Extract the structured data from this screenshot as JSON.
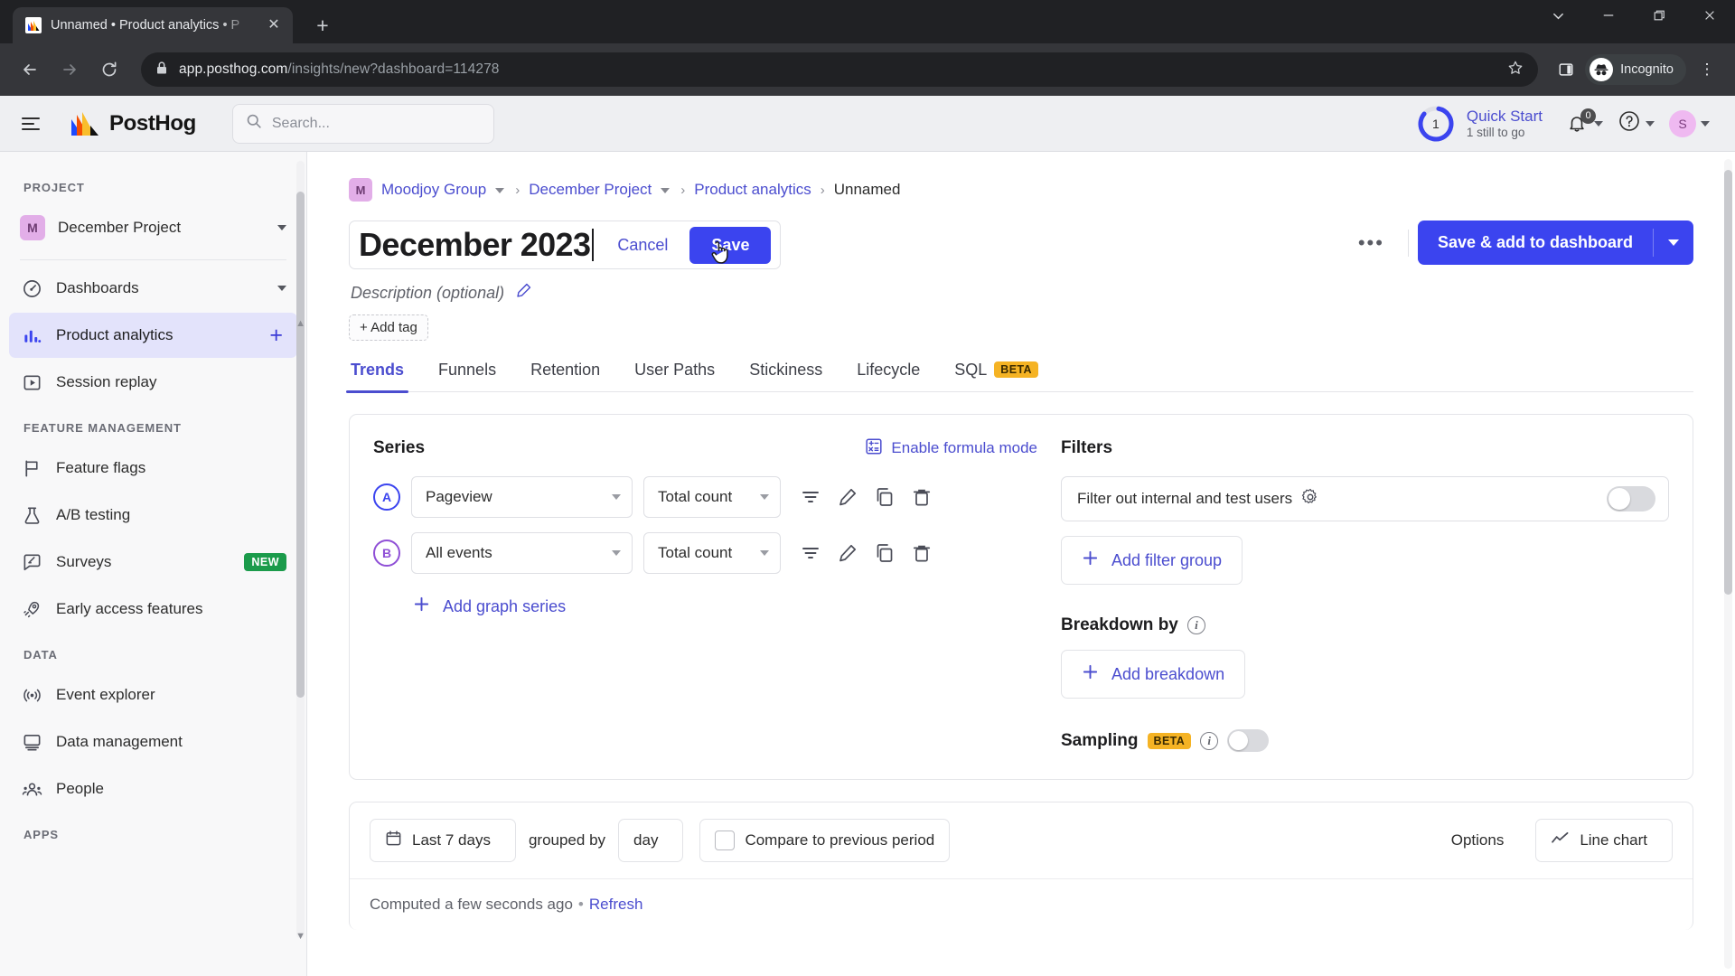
{
  "browser": {
    "tab": {
      "title": "Unnamed • Product analytics • P",
      "close_label": "✕"
    },
    "new_tab_label": "+",
    "url_main": "app.posthog.com",
    "url_path": "/insights/new?dashboard=114278",
    "profile_label": "Incognito",
    "window": {
      "minimize": "—",
      "maximize": "❐",
      "close": "✕"
    }
  },
  "topnav": {
    "brand": "PostHog",
    "search": {
      "placeholder": "Search..."
    },
    "quick_start": {
      "title": "Quick Start",
      "subtitle": "1 still to go",
      "progress_number": "1"
    },
    "notifications_count": "0",
    "avatar_initial": "S"
  },
  "sidebar": {
    "sections": [
      {
        "title": "PROJECT"
      },
      {
        "title": "FEATURE MANAGEMENT"
      },
      {
        "title": "DATA"
      },
      {
        "title": "APPS"
      }
    ],
    "project": {
      "badge": "M",
      "name": "December Project"
    },
    "items": [
      {
        "label": "Dashboards",
        "icon": "dashboard-icon",
        "has_caret": true
      },
      {
        "label": "Product analytics",
        "icon": "bar-chart-icon",
        "active": true,
        "has_plus": true
      },
      {
        "label": "Session replay",
        "icon": "play-square-icon"
      },
      {
        "label": "Feature flags",
        "icon": "flag-icon"
      },
      {
        "label": "A/B testing",
        "icon": "flask-icon"
      },
      {
        "label": "Surveys",
        "icon": "survey-icon",
        "badge": "NEW"
      },
      {
        "label": "Early access features",
        "icon": "rocket-icon"
      },
      {
        "label": "Event explorer",
        "icon": "broadcast-icon"
      },
      {
        "label": "Data management",
        "icon": "database-icon"
      },
      {
        "label": "People",
        "icon": "people-icon"
      }
    ]
  },
  "breadcrumb": {
    "org_badge": "M",
    "org": "Moodjoy Group",
    "project": "December Project",
    "product": "Product analytics",
    "current": "Unnamed",
    "separator": "›"
  },
  "insight": {
    "title_value": "December 2023",
    "cancel_label": "Cancel",
    "save_label": "Save",
    "more_label": "•••",
    "save_add_dashboard_label": "Save & add to dashboard",
    "description_placeholder": "Description (optional)",
    "add_tag_label": "+ Add tag"
  },
  "tabs": [
    {
      "label": "Trends",
      "active": true
    },
    {
      "label": "Funnels"
    },
    {
      "label": "Retention"
    },
    {
      "label": "User Paths"
    },
    {
      "label": "Stickiness"
    },
    {
      "label": "Lifecycle"
    },
    {
      "label": "SQL",
      "badge": "BETA"
    }
  ],
  "query": {
    "series_title": "Series",
    "formula_link": "Enable formula mode",
    "rows": [
      {
        "badge": "A",
        "event": "Pageview",
        "math": "Total count"
      },
      {
        "badge": "B",
        "event": "All events",
        "math": "Total count"
      }
    ],
    "add_series_label": "Add graph series",
    "filters_title": "Filters",
    "internal_users_label": "Filter out internal and test users",
    "add_filter_group_label": "Add filter group",
    "breakdown_title": "Breakdown by",
    "add_breakdown_label": "Add breakdown",
    "sampling_title": "Sampling",
    "sampling_badge": "BETA"
  },
  "toolbar": {
    "date_range": "Last 7 days",
    "grouped_by_text": "grouped by",
    "interval": "day",
    "compare_label": "Compare to previous period",
    "options_label": "Options",
    "chart_type": "Line chart",
    "status_text": "Computed a few seconds ago",
    "status_dot": "•",
    "refresh_label": "Refresh"
  },
  "colors": {
    "primary": "#3b44ef",
    "link": "#4b4dcf",
    "series_a": "#3b44ef",
    "series_b": "#8f4fd6",
    "beta_badge": "#f5b324",
    "new_badge": "#1b9b4b"
  }
}
